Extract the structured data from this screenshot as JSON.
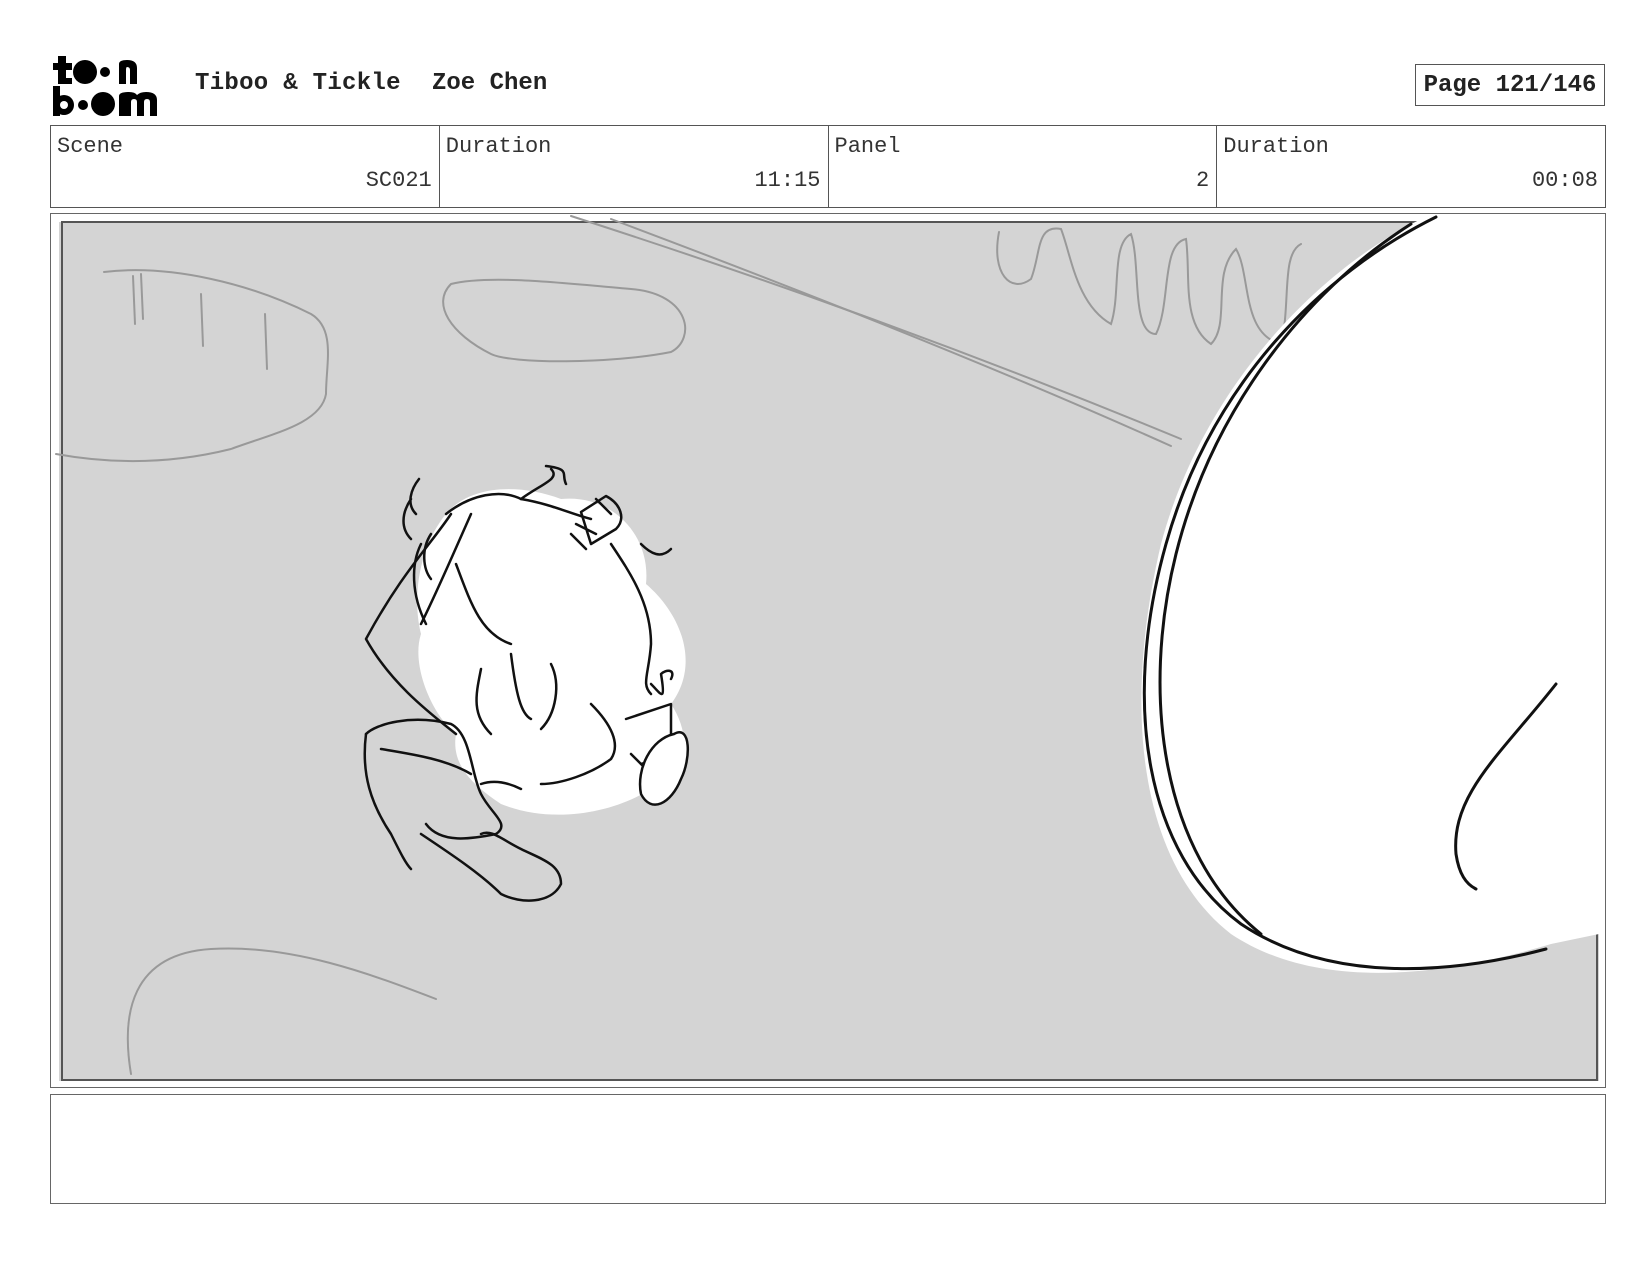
{
  "header": {
    "logo_line1": "toon",
    "logo_line2": "boom",
    "project_title": "Tiboo & Tickle",
    "author": "Zoe Chen",
    "page_label": "Page 121/146"
  },
  "info": {
    "scene_label": "Scene",
    "scene_value": "SC021",
    "scene_duration_label": "Duration",
    "scene_duration_value": "11:15",
    "panel_label": "Panel",
    "panel_value": "2",
    "panel_duration_label": "Duration",
    "panel_duration_value": "00:08"
  },
  "colors": {
    "panel_background": "#d4d4d4",
    "sketch_line": "#111111",
    "rough_line": "#999999"
  },
  "notes": {
    "text": ""
  }
}
